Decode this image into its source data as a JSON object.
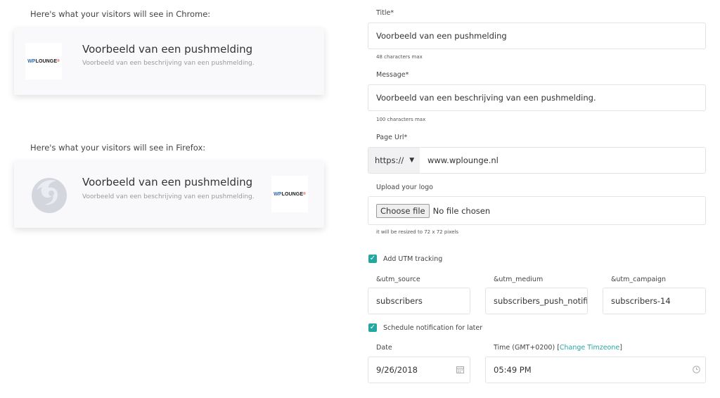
{
  "preview": {
    "chrome_caption": "Here's what your visitors will see in Chrome:",
    "firefox_caption": "Here's what your visitors will see in Firefox:",
    "notification_title": "Voorbeeld van een pushmelding",
    "notification_description": "Voorbeeld van een beschrijving van een pushmelding.",
    "logo_wp": "WP",
    "logo_rest": "LOUNGE",
    "logo_mark": "®"
  },
  "form": {
    "title_label": "Title*",
    "title_value": "Voorbeeld van een pushmelding",
    "title_hint": "48 characters max",
    "message_label": "Message*",
    "message_value": "Voorbeeld van een beschrijving van een pushmelding.",
    "message_hint": "100 characters max",
    "url_label": "Page Url*",
    "protocol": "https://",
    "url_value": "www.wplounge.nl",
    "logo_label": "Upload your logo",
    "choose_file": "Choose file",
    "no_file": "No file chosen",
    "logo_hint": "it will be resized to 72 x 72 pixels",
    "utm_checkbox": "Add UTM tracking",
    "utm_source_label": "&utm_source",
    "utm_medium_label": "&utm_medium",
    "utm_campaign_label": "&utm_campaign",
    "utm_source_value": "subscribers",
    "utm_medium_value": "subscribers_push_notifi",
    "utm_campaign_value": "subscribers-14",
    "schedule_checkbox": "Schedule notification for later",
    "date_label": "Date",
    "time_label_prefix": "Time (GMT+0200) [",
    "time_label_link": "Change Timzeone",
    "time_label_suffix": "]",
    "date_value": "9/26/2018",
    "time_value": "05:49 PM"
  },
  "colors": {
    "accent": "#25a7a1",
    "card_bg": "#f9f9fb",
    "border": "#e3e3e3"
  }
}
